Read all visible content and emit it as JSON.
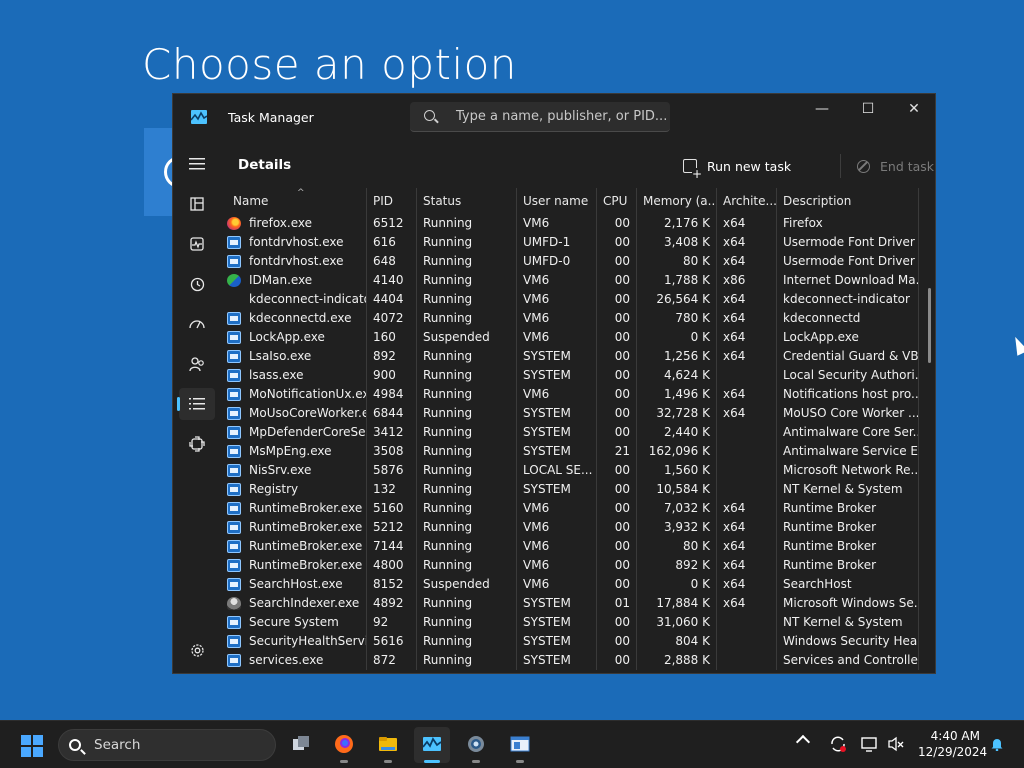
{
  "background": {
    "title": "Choose an option"
  },
  "window": {
    "title": "Task Manager",
    "search_placeholder": "Type a name, publisher, or PID...",
    "minimize": "—",
    "maximize": "☐",
    "close": "✕"
  },
  "commandbar": {
    "page_title": "Details",
    "run_new_task": "Run new task",
    "end_task": "End task",
    "more": "•••"
  },
  "columns": [
    "Name",
    "PID",
    "Status",
    "User name",
    "CPU",
    "Memory (a...",
    "Archite...",
    "Description"
  ],
  "rows": [
    {
      "icon": "firefox-icon",
      "name": "firefox.exe",
      "pid": "6512",
      "status": "Running",
      "user": "VM6",
      "cpu": "00",
      "memory": "2,176 K",
      "arch": "x64",
      "desc": "Firefox"
    },
    {
      "icon": "app-window-icon",
      "name": "fontdrvhost.exe",
      "pid": "616",
      "status": "Running",
      "user": "UMFD-1",
      "cpu": "00",
      "memory": "3,408 K",
      "arch": "x64",
      "desc": "Usermode Font Driver ..."
    },
    {
      "icon": "app-window-icon",
      "name": "fontdrvhost.exe",
      "pid": "648",
      "status": "Running",
      "user": "UMFD-0",
      "cpu": "00",
      "memory": "80 K",
      "arch": "x64",
      "desc": "Usermode Font Driver ..."
    },
    {
      "icon": "idm-icon",
      "name": "IDMan.exe",
      "pid": "4140",
      "status": "Running",
      "user": "VM6",
      "cpu": "00",
      "memory": "1,788 K",
      "arch": "x86",
      "desc": "Internet Download Ma..."
    },
    {
      "icon": "no-icon",
      "name": "kdeconnect-indicato...",
      "pid": "4404",
      "status": "Running",
      "user": "VM6",
      "cpu": "00",
      "memory": "26,564 K",
      "arch": "x64",
      "desc": "kdeconnect-indicator"
    },
    {
      "icon": "app-window-icon",
      "name": "kdeconnectd.exe",
      "pid": "4072",
      "status": "Running",
      "user": "VM6",
      "cpu": "00",
      "memory": "780 K",
      "arch": "x64",
      "desc": "kdeconnectd"
    },
    {
      "icon": "app-window-icon",
      "name": "LockApp.exe",
      "pid": "160",
      "status": "Suspended",
      "user": "VM6",
      "cpu": "00",
      "memory": "0 K",
      "arch": "x64",
      "desc": "LockApp.exe"
    },
    {
      "icon": "app-window-icon",
      "name": "LsaIso.exe",
      "pid": "892",
      "status": "Running",
      "user": "SYSTEM",
      "cpu": "00",
      "memory": "1,256 K",
      "arch": "x64",
      "desc": "Credential Guard & VB..."
    },
    {
      "icon": "app-window-icon",
      "name": "lsass.exe",
      "pid": "900",
      "status": "Running",
      "user": "SYSTEM",
      "cpu": "00",
      "memory": "4,624 K",
      "arch": "",
      "desc": "Local Security Authori..."
    },
    {
      "icon": "app-window-icon",
      "name": "MoNotificationUx.exe",
      "pid": "4984",
      "status": "Running",
      "user": "VM6",
      "cpu": "00",
      "memory": "1,496 K",
      "arch": "x64",
      "desc": "Notifications host pro..."
    },
    {
      "icon": "app-window-icon",
      "name": "MoUsoCoreWorker.e...",
      "pid": "6844",
      "status": "Running",
      "user": "SYSTEM",
      "cpu": "00",
      "memory": "32,728 K",
      "arch": "x64",
      "desc": "MoUSO Core Worker ..."
    },
    {
      "icon": "app-window-icon",
      "name": "MpDefenderCoreSer...",
      "pid": "3412",
      "status": "Running",
      "user": "SYSTEM",
      "cpu": "00",
      "memory": "2,440 K",
      "arch": "",
      "desc": "Antimalware Core Ser..."
    },
    {
      "icon": "app-window-icon",
      "name": "MsMpEng.exe",
      "pid": "3508",
      "status": "Running",
      "user": "SYSTEM",
      "cpu": "21",
      "memory": "162,096 K",
      "arch": "",
      "desc": "Antimalware Service E..."
    },
    {
      "icon": "app-window-icon",
      "name": "NisSrv.exe",
      "pid": "5876",
      "status": "Running",
      "user": "LOCAL SE...",
      "cpu": "00",
      "memory": "1,560 K",
      "arch": "",
      "desc": "Microsoft Network Re..."
    },
    {
      "icon": "app-window-icon",
      "name": "Registry",
      "pid": "132",
      "status": "Running",
      "user": "SYSTEM",
      "cpu": "00",
      "memory": "10,584 K",
      "arch": "",
      "desc": "NT Kernel & System"
    },
    {
      "icon": "app-window-icon",
      "name": "RuntimeBroker.exe",
      "pid": "5160",
      "status": "Running",
      "user": "VM6",
      "cpu": "00",
      "memory": "7,032 K",
      "arch": "x64",
      "desc": "Runtime Broker"
    },
    {
      "icon": "app-window-icon",
      "name": "RuntimeBroker.exe",
      "pid": "5212",
      "status": "Running",
      "user": "VM6",
      "cpu": "00",
      "memory": "3,932 K",
      "arch": "x64",
      "desc": "Runtime Broker"
    },
    {
      "icon": "app-window-icon",
      "name": "RuntimeBroker.exe",
      "pid": "7144",
      "status": "Running",
      "user": "VM6",
      "cpu": "00",
      "memory": "80 K",
      "arch": "x64",
      "desc": "Runtime Broker"
    },
    {
      "icon": "app-window-icon",
      "name": "RuntimeBroker.exe",
      "pid": "4800",
      "status": "Running",
      "user": "VM6",
      "cpu": "00",
      "memory": "892 K",
      "arch": "x64",
      "desc": "Runtime Broker"
    },
    {
      "icon": "app-window-icon",
      "name": "SearchHost.exe",
      "pid": "8152",
      "status": "Suspended",
      "user": "VM6",
      "cpu": "00",
      "memory": "0 K",
      "arch": "x64",
      "desc": "SearchHost"
    },
    {
      "icon": "search-indexer-icon",
      "name": "SearchIndexer.exe",
      "pid": "4892",
      "status": "Running",
      "user": "SYSTEM",
      "cpu": "01",
      "memory": "17,884 K",
      "arch": "x64",
      "desc": "Microsoft Windows Se..."
    },
    {
      "icon": "app-window-icon",
      "name": "Secure System",
      "pid": "92",
      "status": "Running",
      "user": "SYSTEM",
      "cpu": "00",
      "memory": "31,060 K",
      "arch": "",
      "desc": "NT Kernel & System"
    },
    {
      "icon": "app-window-icon",
      "name": "SecurityHealthServic...",
      "pid": "5616",
      "status": "Running",
      "user": "SYSTEM",
      "cpu": "00",
      "memory": "804 K",
      "arch": "",
      "desc": "Windows Security Hea..."
    },
    {
      "icon": "app-window-icon",
      "name": "services.exe",
      "pid": "872",
      "status": "Running",
      "user": "SYSTEM",
      "cpu": "00",
      "memory": "2,888 K",
      "arch": "",
      "desc": "Services and Controlle..."
    }
  ],
  "taskbar": {
    "search_label": "Search",
    "time": "4:40 AM",
    "date": "12/29/2024"
  },
  "colors": {
    "desktop": "#1b6bb8",
    "window_bg": "#202020",
    "accent": "#4cc2ff"
  }
}
